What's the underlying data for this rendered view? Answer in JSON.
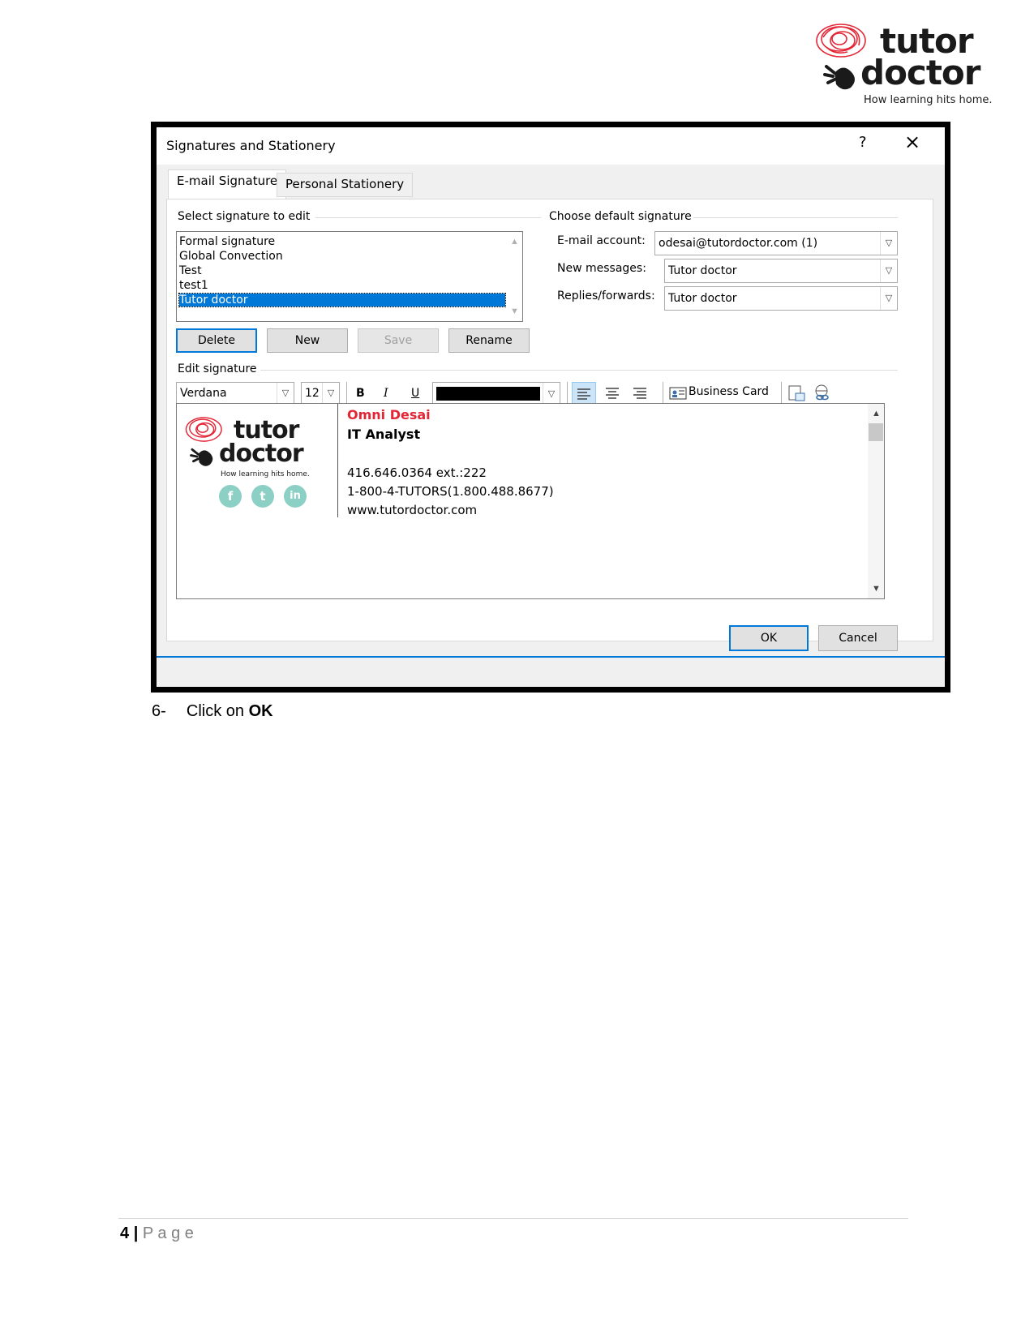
{
  "header_logo": {
    "word1": "tutor",
    "word2": "doctor",
    "tagline": "How learning hits home."
  },
  "dialog": {
    "title": "Signatures and Stationery",
    "help_glyph": "?",
    "close_glyph": "×",
    "tabs": [
      "E-mail Signature",
      "Personal Stationery"
    ],
    "select_group_label": "Select signature to edit",
    "signatures": [
      "Formal signature",
      "Global Convection",
      "Test",
      "test1",
      "Tutor doctor"
    ],
    "selected_signature": "Tutor doctor",
    "buttons": {
      "delete": "Delete",
      "new": "New",
      "save": "Save",
      "rename": "Rename"
    },
    "default_group_label": "Choose default signature",
    "email_account_label": "E-mail account:",
    "email_account_value": "odesai@tutordoctor.com (1)",
    "new_messages_label": "New messages:",
    "new_messages_value": "Tutor doctor",
    "replies_label": "Replies/forwards:",
    "replies_value": "Tutor doctor",
    "edit_group_label": "Edit signature",
    "font_name": "Verdana",
    "font_size": "12",
    "bold": "B",
    "italic": "I",
    "underline": "U",
    "business_card": "Business Card",
    "signature_content": {
      "logo_word1": "tutor",
      "logo_word2": "doctor",
      "logo_tagline": "How learning hits home.",
      "social": [
        "f",
        "t",
        "in"
      ],
      "name": "Omni Desai",
      "title": "IT Analyst",
      "phone": "416.646.0364 ext.:222",
      "tollfree": "1-800-4-TUTORS(1.800.488.8677)",
      "website": "www.tutordoctor.com"
    },
    "ok": "OK",
    "cancel": "Cancel"
  },
  "instruction": {
    "number": "6-",
    "text": "Click on ",
    "bold_text": "OK"
  },
  "footer": {
    "page_number": "4",
    "separator": "|",
    "page_label": "P a g e"
  },
  "colors": {
    "brand_red": "#e32636",
    "selection_blue": "#0078d7",
    "social_teal": "#8ccfc4"
  }
}
